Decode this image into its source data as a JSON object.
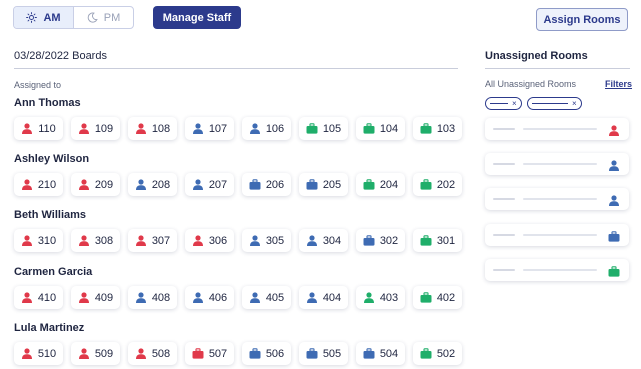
{
  "toggle": {
    "am_label": "AM",
    "pm_label": "PM",
    "active": "AM"
  },
  "header": {
    "manage_staff": "Manage Staff",
    "assign_rooms": "Assign Rooms"
  },
  "board": {
    "title": "03/28/2022 Boards",
    "assigned_to": "Assigned to"
  },
  "colors": {
    "red": "#e0394a",
    "blue": "#3e6bb3",
    "green": "#1fae6a",
    "navy": "#2c3a8c"
  },
  "staff": [
    {
      "name": "Ann Thomas",
      "rooms": [
        {
          "number": "110",
          "icon": "person-icon",
          "color": "red"
        },
        {
          "number": "109",
          "icon": "person-icon",
          "color": "red"
        },
        {
          "number": "108",
          "icon": "person-icon",
          "color": "red"
        },
        {
          "number": "107",
          "icon": "person-icon",
          "color": "blue"
        },
        {
          "number": "106",
          "icon": "person-icon",
          "color": "blue"
        },
        {
          "number": "105",
          "icon": "briefcase-icon",
          "color": "green"
        },
        {
          "number": "104",
          "icon": "briefcase-icon",
          "color": "green"
        },
        {
          "number": "103",
          "icon": "briefcase-icon",
          "color": "green"
        }
      ]
    },
    {
      "name": "Ashley Wilson",
      "rooms": [
        {
          "number": "210",
          "icon": "person-icon",
          "color": "red"
        },
        {
          "number": "209",
          "icon": "person-icon",
          "color": "red"
        },
        {
          "number": "208",
          "icon": "person-icon",
          "color": "blue"
        },
        {
          "number": "207",
          "icon": "person-icon",
          "color": "blue"
        },
        {
          "number": "206",
          "icon": "briefcase-icon",
          "color": "blue"
        },
        {
          "number": "205",
          "icon": "briefcase-icon",
          "color": "blue"
        },
        {
          "number": "204",
          "icon": "briefcase-icon",
          "color": "green"
        },
        {
          "number": "202",
          "icon": "briefcase-icon",
          "color": "green"
        }
      ]
    },
    {
      "name": "Beth Williams",
      "rooms": [
        {
          "number": "310",
          "icon": "person-icon",
          "color": "red"
        },
        {
          "number": "308",
          "icon": "person-icon",
          "color": "red"
        },
        {
          "number": "307",
          "icon": "person-icon",
          "color": "red"
        },
        {
          "number": "306",
          "icon": "person-icon",
          "color": "red"
        },
        {
          "number": "305",
          "icon": "person-icon",
          "color": "blue"
        },
        {
          "number": "304",
          "icon": "person-icon",
          "color": "blue"
        },
        {
          "number": "302",
          "icon": "briefcase-icon",
          "color": "blue"
        },
        {
          "number": "301",
          "icon": "briefcase-icon",
          "color": "green"
        }
      ]
    },
    {
      "name": "Carmen Garcia",
      "rooms": [
        {
          "number": "410",
          "icon": "person-icon",
          "color": "red"
        },
        {
          "number": "409",
          "icon": "person-icon",
          "color": "red"
        },
        {
          "number": "408",
          "icon": "person-icon",
          "color": "blue"
        },
        {
          "number": "406",
          "icon": "person-icon",
          "color": "blue"
        },
        {
          "number": "405",
          "icon": "person-icon",
          "color": "blue"
        },
        {
          "number": "404",
          "icon": "person-icon",
          "color": "blue"
        },
        {
          "number": "403",
          "icon": "person-icon",
          "color": "green"
        },
        {
          "number": "402",
          "icon": "briefcase-icon",
          "color": "green"
        }
      ]
    },
    {
      "name": "Lula Martinez",
      "rooms": [
        {
          "number": "510",
          "icon": "person-icon",
          "color": "red"
        },
        {
          "number": "509",
          "icon": "person-icon",
          "color": "red"
        },
        {
          "number": "508",
          "icon": "person-icon",
          "color": "red"
        },
        {
          "number": "507",
          "icon": "briefcase-icon",
          "color": "red"
        },
        {
          "number": "506",
          "icon": "briefcase-icon",
          "color": "blue"
        },
        {
          "number": "505",
          "icon": "briefcase-icon",
          "color": "blue"
        },
        {
          "number": "504",
          "icon": "briefcase-icon",
          "color": "blue"
        },
        {
          "number": "502",
          "icon": "briefcase-icon",
          "color": "green"
        }
      ]
    }
  ],
  "unassigned": {
    "title": "Unassigned Rooms",
    "subtitle": "All Unassigned Rooms",
    "filters_link": "Filters",
    "cards": [
      {
        "icon": "person-icon",
        "color": "red"
      },
      {
        "icon": "person-icon",
        "color": "blue"
      },
      {
        "icon": "person-icon",
        "color": "blue"
      },
      {
        "icon": "briefcase-icon",
        "color": "blue"
      },
      {
        "icon": "briefcase-icon",
        "color": "green"
      }
    ]
  }
}
